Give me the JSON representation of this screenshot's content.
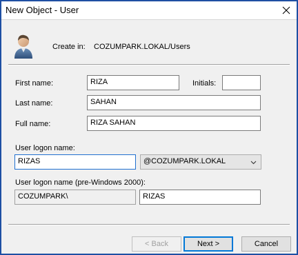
{
  "window": {
    "title": "New Object - User"
  },
  "header": {
    "create_in_label": "Create in:",
    "create_in_path": "COZUMPARK.LOKAL/Users"
  },
  "form": {
    "first_name_label": "First name:",
    "first_name_value": "RIZA",
    "initials_label": "Initials:",
    "initials_value": "",
    "last_name_label": "Last name:",
    "last_name_value": "SAHAN",
    "full_name_label": "Full name:",
    "full_name_value": "RIZA SAHAN",
    "logon_name_label": "User logon name:",
    "logon_name_value": "RIZAS",
    "domain_suffix_value": "@COZUMPARK.LOKAL",
    "pre2000_label": "User logon name (pre-Windows 2000):",
    "pre2000_domain_value": "COZUMPARK\\",
    "pre2000_name_value": "RIZAS"
  },
  "buttons": {
    "back_label": "< Back",
    "next_label": "Next >",
    "cancel_label": "Cancel"
  },
  "icons": {
    "close": "close-icon",
    "user": "user-icon",
    "dropdown": "chevron-down-icon"
  },
  "colors": {
    "window_border": "#1e4fa3",
    "focus_border": "#1e6fd0",
    "default_button_border": "#0078d7",
    "dialog_bg": "#f0f0f0"
  }
}
